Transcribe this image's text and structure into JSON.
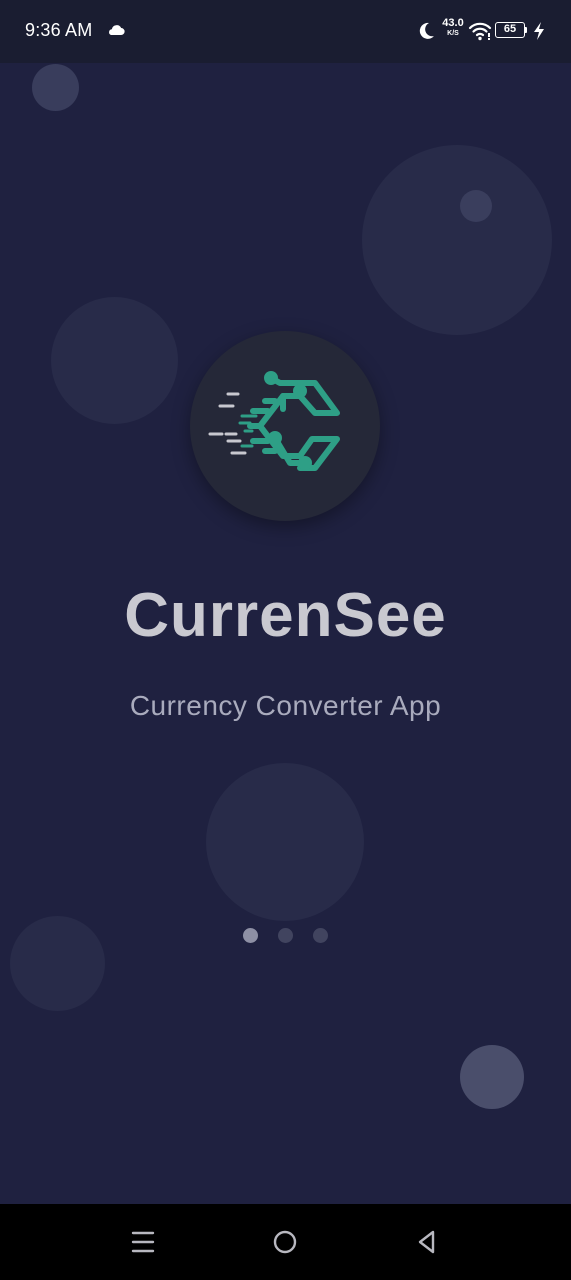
{
  "status_bar": {
    "time": "9:36 AM",
    "net_speed": "43.0",
    "net_unit": "K/S",
    "battery": "65",
    "icons": [
      "cloud-icon",
      "moon-icon",
      "wifi-icon",
      "battery-icon",
      "charging-bolt-icon"
    ]
  },
  "splash": {
    "app_name": "CurrenSee",
    "tagline": "Currency Converter App",
    "logo_icon": "currensee-logo-icon",
    "page_indicator": {
      "total": 3,
      "active": 1
    }
  },
  "nav_bar": {
    "icons": [
      "menu-icon",
      "home-icon",
      "back-icon"
    ]
  },
  "colors": {
    "background": "#1f2140",
    "status_bar": "#1a1d31",
    "logo_circle": "#252838",
    "logo_accent": "#2e9f86",
    "title": "#c9c9d0",
    "subtitle": "#a9abbd"
  }
}
